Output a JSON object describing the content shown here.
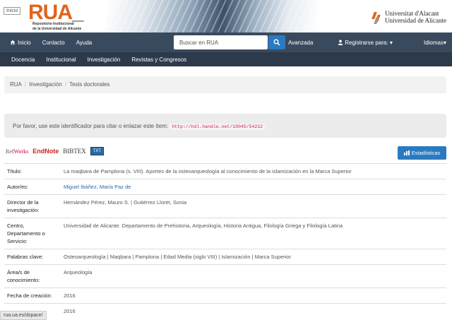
{
  "banner": {
    "inicio": "Inicio",
    "logo_main": "RUA",
    "logo_sub1": "Repositorio Institucional",
    "logo_sub2": "de la Universidad de Alicante",
    "univ_line1": "Universitat d'Alacant",
    "univ_line2": "Universidad de Alicante"
  },
  "nav": {
    "home": "Inicio",
    "contact": "Contacto",
    "help": "Ayuda",
    "search_placeholder": "Buscar en RUA",
    "advanced": "Avanzada",
    "register": "Registrarse para:",
    "languages": "Idiomas"
  },
  "nav2": [
    "Docencia",
    "Institucional",
    "Investigación",
    "Revistas y Congresos"
  ],
  "breadcrumb": [
    "RUA",
    "Investigación",
    "Tesis doctorales"
  ],
  "alert": {
    "text": "Por favor, use este identificador para citar o enlazar este ítem:",
    "handle": "http://hdl.handle.net/10045/54212"
  },
  "exports": {
    "refworks_a": "Ref",
    "refworks_b": "Works",
    "endnote": "EndNote",
    "bibtex": "BIBTEX",
    "txt": "TXT"
  },
  "stats_button": "Estadísticas",
  "record": [
    {
      "k": "Título:",
      "v": "La maqbara de Pamplona (s. VIII). Aportes de la osteoarqueología al conocimiento de la islamización en la Marca Superior"
    },
    {
      "k": "Autor/es:",
      "v": "Miguel Ibáñez, María Paz de"
    },
    {
      "k": "Director de la investigación:",
      "v": "Hernández Pérez, Mauro S. | Gutiérrez Lloret, Sonia"
    },
    {
      "k": "Centro, Departamento o Servicio:",
      "v": "Universidad de Alicante. Departamento de Prehistoria, Arqueología, Historia Antigua, Filología Griega y Filología Latina"
    },
    {
      "k": "Palabras clave:",
      "v": "Osteoarqueología | Maqbara | Pamplona | Edad Media (siglo VIII) | Islamización | Marca Superior"
    },
    {
      "k": "Área/s de conocimiento:",
      "v": "Arqueología"
    },
    {
      "k": "Fecha de creación:",
      "v": "2016"
    },
    {
      "k": "",
      "v": "2016"
    }
  ],
  "status_url": "rua.ua.es/dspace/"
}
